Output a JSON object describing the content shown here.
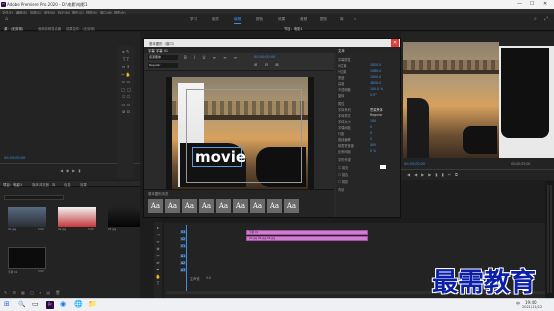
{
  "app": {
    "title": "Adobe Premiere Pro 2020 - D:\\电影\\电影1",
    "win_controls": [
      "—",
      "☐",
      "✕"
    ]
  },
  "menu": [
    "文件(F)",
    "编辑(E)",
    "剪辑(C)",
    "序列(S)",
    "标记(M)",
    "图形(G)",
    "视图(V)",
    "窗口(W)",
    "帮助(H)"
  ],
  "workspaces": {
    "items": [
      "学习",
      "组件",
      "编辑",
      "颜色",
      "效果",
      "音频",
      "图形",
      "库",
      "»"
    ],
    "active": "编辑"
  },
  "panels": {
    "source": "源：(无剪辑)",
    "audio_mixer": "音频剪辑混合器",
    "effects_tab": "效果控件：(无剪辑)",
    "program": "节目：电影1"
  },
  "essential_graphics": {
    "title": "基本图形（窗口）",
    "tab_left": "字幕 字幕 01",
    "tab_right": "文本",
    "font": "思源黑体",
    "font_style": "Regular",
    "title_text": "movie",
    "timecode": "00:00:00:00",
    "section_header": "基本图形面板",
    "props": {
      "labels": [
        "字幕属性",
        "X位置",
        "Y位置",
        "宽度",
        "高度",
        "不透明度",
        "旋转",
        "属性",
        "字体系列",
        "字体样式",
        "字体大小",
        "字偶间距",
        "行距",
        "基线偏移",
        "制表符宽度",
        "比例间距",
        "字形外观",
        "填充",
        "描边",
        "背景"
      ],
      "values": [
        "",
        "1920.0",
        "1080.0",
        "1000.0",
        "4800.0",
        "100.0 %",
        "0.0°",
        "",
        "思源黑体",
        "Regular",
        "100",
        "0",
        "0",
        "0",
        "400",
        "0 %",
        "",
        "",
        "",
        ""
      ],
      "checkbox_fill": "填充",
      "checkbox_stroke": "描边",
      "checkbox_shadow": "阴影"
    },
    "style_tiles": [
      "Aa",
      "Aa",
      "Aa",
      "Aa",
      "Aa",
      "Aa",
      "Aa",
      "Aa",
      "Aa"
    ],
    "style_header": "基本图形浏览",
    "sample_text": "Aa"
  },
  "program_monitor": {
    "timecode_left": "00;00;00;00",
    "timecode_right": "00;00;05;00",
    "fit": "适合",
    "res": "完整"
  },
  "project": {
    "title": "项目：电影1",
    "tab2": "媒体浏览器",
    "tab3": "库",
    "tab4": "信息",
    "tab5": "效果",
    "items": [
      {
        "name": "01.jpg",
        "dur": "5:00"
      },
      {
        "name": "02.jpg",
        "dur": "5:00"
      },
      {
        "name": "03.jpg",
        "dur": "5:00"
      },
      {
        "name": "字幕 01",
        "dur": "5:00"
      }
    ]
  },
  "timeline": {
    "tracks": [
      "V3",
      "V2",
      "V1",
      "A1",
      "A2",
      "A3"
    ],
    "clips": [
      "字幕 01",
      "01.jpg 02.jpg 03.jpg"
    ],
    "master": "主声道",
    "master_val": "0.0"
  },
  "source_timecode": "00;00;00;00",
  "watermark": "最需教育",
  "taskbar": {
    "time": "19:40",
    "date": "2021/11/12",
    "lang": "中",
    "items": [
      "⊞",
      "🔍",
      "▭",
      "Pr",
      "◉",
      "🌐",
      "📁"
    ]
  },
  "colors": {
    "accent": "#3d8fe0",
    "clip": "#d07ed0",
    "close": "#e23b3b"
  }
}
